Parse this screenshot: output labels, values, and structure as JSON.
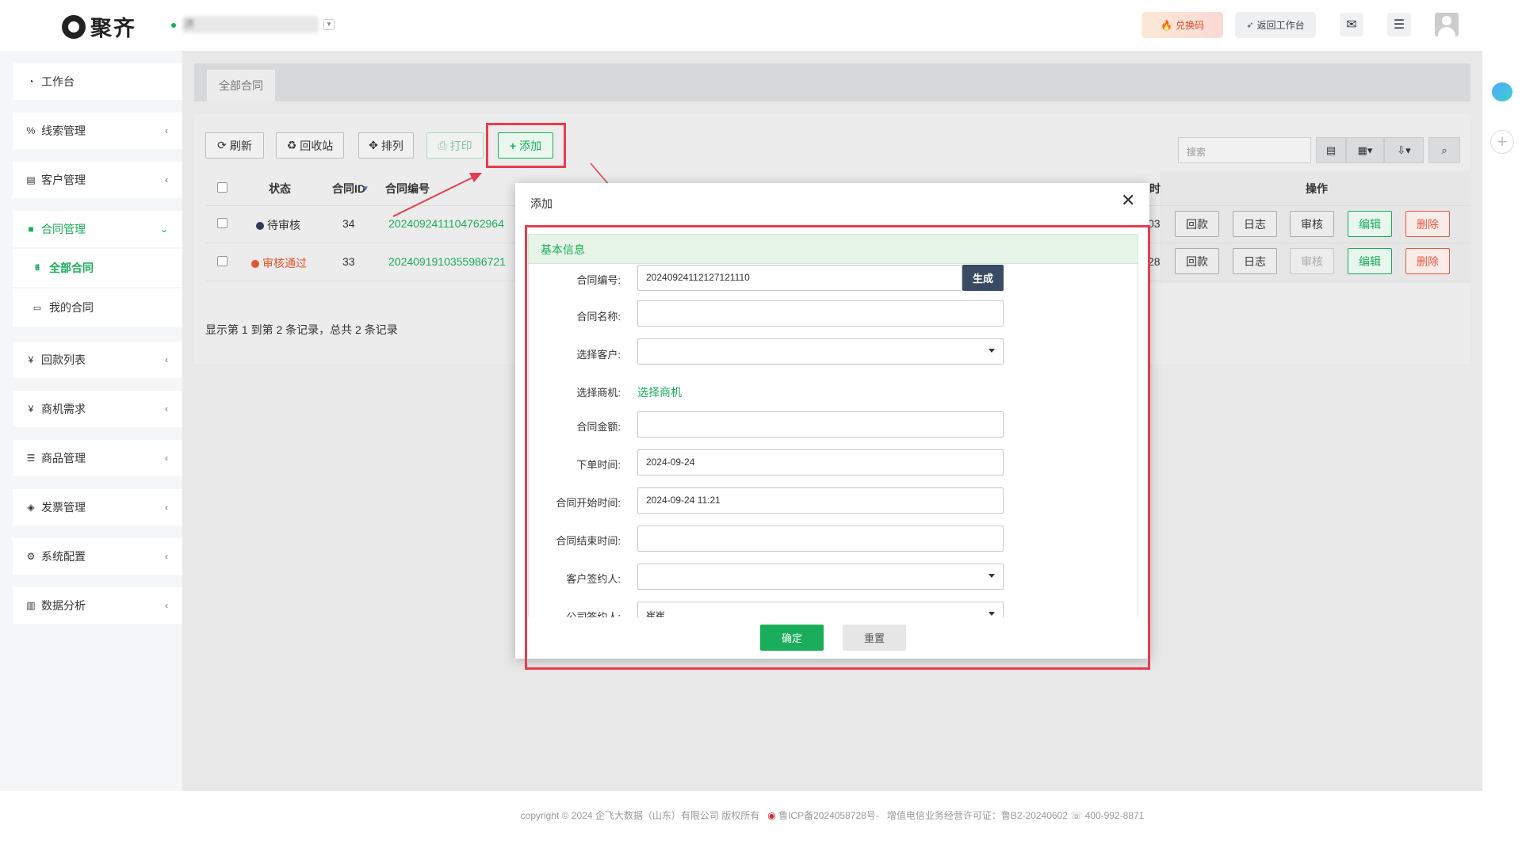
{
  "header": {
    "logo_text": "聚齐",
    "org_name": "济",
    "exchange_label": "兑换码",
    "return_label": "返回工作台"
  },
  "sidebar": {
    "items": [
      {
        "icon": "dashboard-icon",
        "label": "工作台"
      },
      {
        "icon": "link-icon",
        "label": "线索管理"
      },
      {
        "icon": "id-card-icon",
        "label": "客户管理"
      },
      {
        "icon": "bookmark-icon",
        "label": "合同管理"
      },
      {
        "icon": "yen-icon",
        "label": "回款列表"
      },
      {
        "icon": "yen-icon",
        "label": "商机需求"
      },
      {
        "icon": "list-icon",
        "label": "商品管理"
      },
      {
        "icon": "ticket-icon",
        "label": "发票管理"
      },
      {
        "icon": "gears-icon",
        "label": "系统配置"
      },
      {
        "icon": "bar-chart-icon",
        "label": "数据分析"
      }
    ],
    "sub_items": [
      {
        "icon": "all-icon",
        "label": "全部合同"
      },
      {
        "icon": "list-alt-icon",
        "label": "我的合同"
      }
    ]
  },
  "tabs": [
    "全部合同"
  ],
  "toolbar": {
    "refresh": "刷新",
    "recycle": "回收站",
    "sort": "排列",
    "print": "打印",
    "add": "添加",
    "search_placeholder": "搜索"
  },
  "table": {
    "columns": [
      "状态",
      "合同ID",
      "合同编号",
      "时",
      "操作"
    ],
    "rows": [
      {
        "status": "待审核",
        "status_color": "#2f3a5c",
        "id": "34",
        "number": "2024092411104762964",
        "time_tail": "03",
        "review_disabled": false
      },
      {
        "status": "审核通过",
        "status_color": "#e2572b",
        "id": "33",
        "number": "2024091910355986721",
        "time_tail": "28",
        "review_disabled": true
      }
    ],
    "actions": [
      "回款",
      "日志",
      "审核",
      "编辑",
      "删除"
    ],
    "pager_text": "显示第 1 到第 2 条记录，总共 2 条记录"
  },
  "modal": {
    "title": "添加",
    "section": "基本信息",
    "generate_label": "生成",
    "choose_opportunity": "选择商机",
    "ok_label": "确定",
    "reset_label": "重置",
    "fields": [
      {
        "label": "合同编号:",
        "value": "20240924112127121110"
      },
      {
        "label": "合同名称:",
        "value": ""
      },
      {
        "label": "选择客户:",
        "value": ""
      },
      {
        "label": "选择商机:",
        "value": ""
      },
      {
        "label": "合同金额:",
        "value": ""
      },
      {
        "label": "下单时间:",
        "value": "2024-09-24"
      },
      {
        "label": "合同开始时间:",
        "value": "2024-09-24 11:21"
      },
      {
        "label": "合同结束时间:",
        "value": ""
      },
      {
        "label": "客户签约人:",
        "value": ""
      },
      {
        "label": "公司签约人:",
        "value": "崔崔"
      }
    ]
  },
  "footer": {
    "copyright": "copyright © 2024 企飞大数据（山东）有限公司 版权所有",
    "icp": "鲁ICP备2024058728号-",
    "license": "增值电信业务经营许可证：鲁B2-20240602",
    "phone": "400-992-8871"
  },
  "colors": {
    "accent": "#1aad5a",
    "highlight": "#e63c4f",
    "danger": "#e85a3f"
  }
}
